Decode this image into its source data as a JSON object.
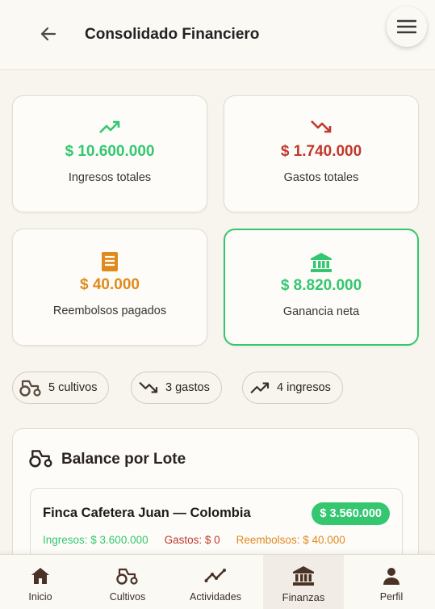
{
  "header": {
    "title": "Consolidado Financiero"
  },
  "colors": {
    "green": "#34c76f",
    "red": "#c0392b",
    "orange": "#e08a1e",
    "brown": "#4a3326"
  },
  "cards": [
    {
      "icon": "trending-up-icon",
      "amount": "$ 10.600.000",
      "label": "Ingresos totales"
    },
    {
      "icon": "trending-down-icon",
      "amount": "$ 1.740.000",
      "label": "Gastos totales"
    },
    {
      "icon": "receipt-icon",
      "amount": "$ 40.000",
      "label": "Reembolsos pagados"
    },
    {
      "icon": "bank-icon",
      "amount": "$ 8.820.000",
      "label": "Ganancia neta"
    }
  ],
  "chips": [
    {
      "icon": "tractor-icon",
      "label": "5 cultivos"
    },
    {
      "icon": "trending-down-icon",
      "label": "3 gastos"
    },
    {
      "icon": "trending-up-icon",
      "label": "4 ingresos"
    }
  ],
  "balance": {
    "title": "Balance por Lote",
    "lotes": [
      {
        "name": "Finca Cafetera Juan — Colombia",
        "total": "$ 3.560.000",
        "ingresos": "Ingresos: $ 3.600.000",
        "gastos": "Gastos: $ 0",
        "reembolsos": "Reembolsos: $ 40.000"
      }
    ]
  },
  "nav": [
    {
      "icon": "home-icon",
      "label": "Inicio"
    },
    {
      "icon": "tractor-icon",
      "label": "Cultivos"
    },
    {
      "icon": "activity-icon",
      "label": "Actividades"
    },
    {
      "icon": "bank-icon",
      "label": "Finanzas",
      "active": true
    },
    {
      "icon": "user-icon",
      "label": "Perfil"
    }
  ]
}
